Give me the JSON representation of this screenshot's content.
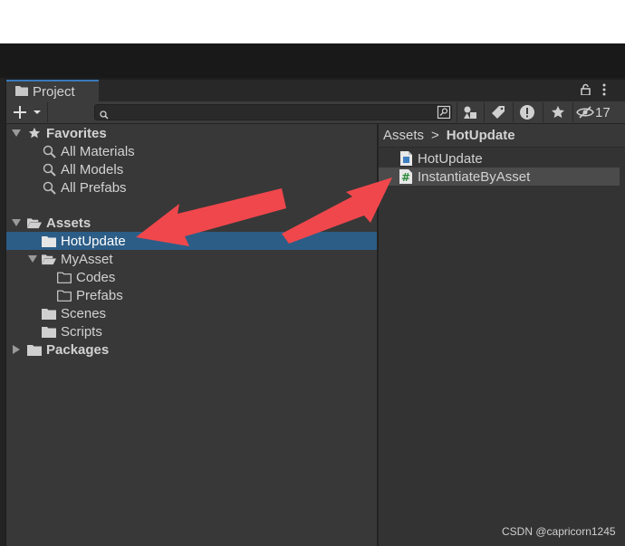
{
  "panel": {
    "tab_label": "Project",
    "hidden_count": "17"
  },
  "tree": {
    "favorites_label": "Favorites",
    "favorites": [
      "All Materials",
      "All Models",
      "All Prefabs"
    ],
    "assets_label": "Assets",
    "hotupdate_label": "HotUpdate",
    "myasset_label": "MyAsset",
    "codes_label": "Codes",
    "prefabs_label": "Prefabs",
    "scenes_label": "Scenes",
    "scripts_label": "Scripts",
    "packages_label": "Packages"
  },
  "breadcrumb": {
    "root": "Assets",
    "separator": ">",
    "current": "HotUpdate"
  },
  "files": [
    {
      "name": "HotUpdate",
      "icon": "assembly-definition-icon"
    },
    {
      "name": "InstantiateByAsset",
      "icon": "csharp-script-icon"
    }
  ],
  "colors": {
    "selection": "#2c5d87",
    "annotation_arrow": "#f0474c"
  },
  "watermark": "CSDN @capricorn1245"
}
